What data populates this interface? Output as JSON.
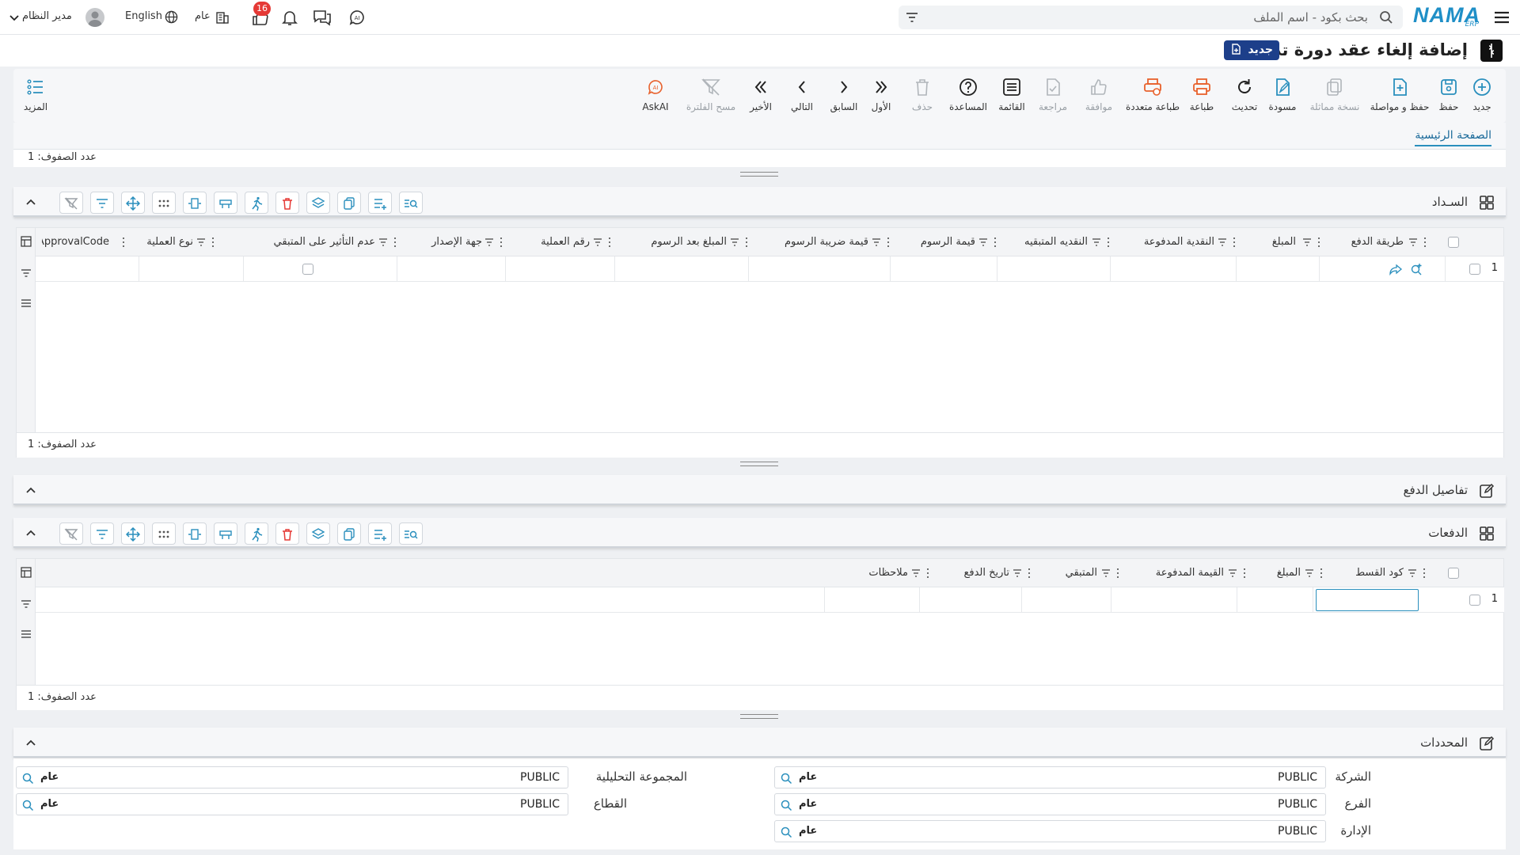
{
  "topbar": {
    "user_name": "مدير النظام",
    "language": "English",
    "branch": "عام",
    "notification_count": "16",
    "search_placeholder": "بحث بكود - اسم الملف",
    "logo": "NAMA",
    "logo_sub": "ERP"
  },
  "page": {
    "title": "إضافة إلغاء عقد دورة تدريبية",
    "badge": "جديد"
  },
  "toolbar": {
    "buttons": [
      {
        "label": "جديد",
        "icon": "plus-circle-icon"
      },
      {
        "label": "حفظ",
        "icon": "save-icon"
      },
      {
        "label": "حفظ و مواصلة",
        "icon": "save-continue-icon"
      },
      {
        "label": "نسخة مماثلة",
        "icon": "copy-icon"
      },
      {
        "label": "مسودة",
        "icon": "draft-icon"
      },
      {
        "label": "تحديث",
        "icon": "refresh-icon"
      },
      {
        "label": "طباعة",
        "icon": "print-icon"
      },
      {
        "label": "طباعة متعددة",
        "icon": "multi-print-icon"
      },
      {
        "label": "موافقة",
        "icon": "approve-icon"
      },
      {
        "label": "مراجعة",
        "icon": "review-icon"
      },
      {
        "label": "القائمة",
        "icon": "list-icon"
      },
      {
        "label": "المساعدة",
        "icon": "help-icon"
      },
      {
        "label": "حذف",
        "icon": "trash-icon"
      },
      {
        "label": "الأول",
        "icon": "first-icon"
      },
      {
        "label": "السابق",
        "icon": "previous-icon"
      },
      {
        "label": "التالي",
        "icon": "next-icon"
      },
      {
        "label": "الأخير",
        "icon": "last-icon"
      },
      {
        "label": "مسح الفلترة",
        "icon": "clear-filter-icon"
      },
      {
        "label": "AskAI",
        "icon": "ai-icon"
      }
    ],
    "more_label": "المزيد"
  },
  "tabs": {
    "main": "الصفحة الرئيسية"
  },
  "row_count_label": "عدد الصفوف: 1",
  "payment_section": {
    "title": "السـداد",
    "columns": [
      "طريقة الدفع",
      "المبلغ",
      "النقدية المدفوعة",
      "النقديه المتبقيه",
      "قيمة الرسوم",
      "قيمة ضريبة الرسوم",
      "المبلغ بعد الرسوم",
      "رقم العملية",
      "جهة الإصدار",
      "عدم التأثير على المتبقي",
      "نوع العملية",
      "ApprovalCode"
    ],
    "row_number": "1"
  },
  "payment_details": {
    "title": "تفاصيل الدفع"
  },
  "installments_section": {
    "title": "الدفعات",
    "columns": [
      "كود القسط",
      "المبلغ",
      "القيمة المدفوعة",
      "المتبقي",
      "تاريخ الدفع",
      "ملاحظات"
    ],
    "row_number": "1"
  },
  "dimensions": {
    "title": "المحددات",
    "fields": [
      {
        "label": "الشركة",
        "value": "PUBLIC",
        "tag": "عام"
      },
      {
        "label": "الفرع",
        "value": "PUBLIC",
        "tag": "عام"
      },
      {
        "label": "الإدارة",
        "value": "PUBLIC",
        "tag": "عام"
      },
      {
        "label": "المجموعة التحليلية",
        "value": "PUBLIC",
        "tag": "عام"
      },
      {
        "label": "القطاع",
        "value": "PUBLIC",
        "tag": "عام"
      }
    ]
  },
  "colors": {
    "accent": "#2a8fbd",
    "brand": "#1d3f8a",
    "danger": "#e53935",
    "orange": "#e8612c"
  }
}
